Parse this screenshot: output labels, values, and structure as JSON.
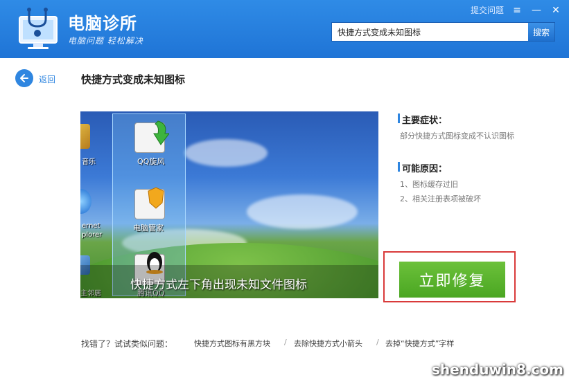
{
  "header": {
    "app_title": "电脑诊所",
    "app_slogan": "电脑问题 轻松解决",
    "feedback_label": "提交问题",
    "menu_glyph": "≡",
    "minimize_glyph": "—",
    "close_glyph": "✕",
    "search_value": "快捷方式变成未知图标",
    "search_button": "搜索"
  },
  "nav": {
    "back_label": "返回",
    "issue_title": "快捷方式变成未知图标"
  },
  "preview": {
    "caption": "快捷方式左下角出现未知文件图标",
    "icons": [
      {
        "label": "QQ旋风"
      },
      {
        "label": "电脑管家"
      },
      {
        "label": "腾讯QQ"
      }
    ],
    "left_strip": [
      "音乐",
      "ernet",
      "plorer",
      "主邻居"
    ]
  },
  "panel": {
    "symptom_title": "主要症状：",
    "symptom_text": "部分快捷方式图标变成不认识图标",
    "cause_title": "可能原因：",
    "causes": [
      "1、图标缓存过旧",
      "2、相关注册表项被破坏"
    ],
    "repair_button": "立即修复"
  },
  "footer": {
    "label": "找错了？试试类似问题：",
    "links": [
      "快捷方式图标有黑方块",
      "去除快捷方式小箭头",
      "去掉“快捷方式”字样"
    ],
    "separator": "/"
  },
  "watermark": "shenduwin8.com",
  "colors": {
    "header_blue": "#2f8be6",
    "accent_blue": "#2f86e0",
    "repair_green": "#4aa622",
    "highlight_red": "#d93a3a"
  }
}
